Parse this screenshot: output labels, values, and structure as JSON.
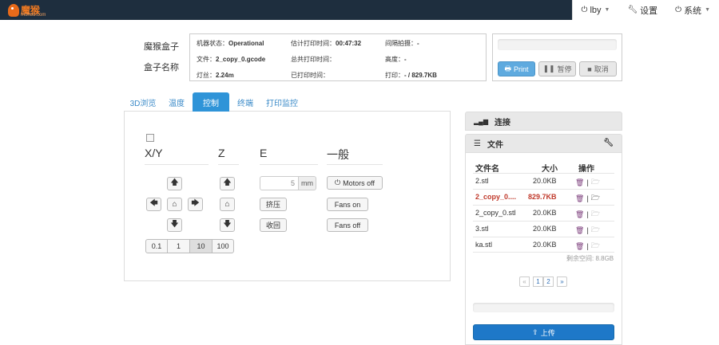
{
  "brand": {
    "name": "魔猴",
    "sub": "mohou.com"
  },
  "nav": {
    "user": "lby",
    "settings": "设置",
    "system": "系统"
  },
  "labels": {
    "box": "魔猴盒子",
    "box_name": "盒子名称"
  },
  "status": {
    "machine_label": "机器状态：",
    "machine_value": "Operational",
    "file_label": "文件：",
    "file_value": "2_copy_0.gcode",
    "filament_label": "灯丝：",
    "filament_value": "2.24m",
    "est_label": "估计打印时间：",
    "est_value": "00:47:32",
    "total_label": "总共打印时间：",
    "total_value": "",
    "printed_label": "已打印时间：",
    "printed_value": "",
    "timelapse_label": "间隔拍摄：",
    "timelapse_value": "-",
    "height_label": "高度：",
    "height_value": "-",
    "print_label": "打印：",
    "print_value": "- / 829.7KB"
  },
  "print_controls": {
    "progress": 0,
    "print": "Print",
    "pause": "暂停",
    "cancel": "取消"
  },
  "tabs": [
    "3D浏览",
    "温度",
    "控制",
    "终端",
    "打印监控"
  ],
  "active_tab": "控制",
  "control": {
    "xy": "X/Y",
    "z": "Z",
    "e": "E",
    "general": "一般",
    "e_amount": "5",
    "e_unit": "mm",
    "extrude": "挤压",
    "retract": "收回",
    "motors_off": "Motors off",
    "fans_on": "Fans on",
    "fans_off": "Fans off",
    "steps": [
      "0.1",
      "1",
      "10",
      "100"
    ],
    "active_step": "10"
  },
  "connection": {
    "title": "连接"
  },
  "files": {
    "title": "文件",
    "col_name": "文件名",
    "col_size": "大小",
    "col_action": "操作",
    "rows": [
      {
        "name": "2.stl",
        "size": "20.0KB"
      },
      {
        "name": "2_copy_0....",
        "size": "829.7KB",
        "highlight": true
      },
      {
        "name": "2_copy_0.stl",
        "size": "20.0KB"
      },
      {
        "name": "3.stl",
        "size": "20.0KB"
      },
      {
        "name": "ka.stl",
        "size": "20.0KB"
      }
    ],
    "free_space": "剩余空间: 8.8GB",
    "pages": [
      "«",
      "1",
      "2",
      "»"
    ],
    "upload_progress": 0,
    "upload": "上传"
  },
  "colors": {
    "navbar": "#1e2e3e",
    "accent": "#2f94d8",
    "highlight_row": "#c0392b",
    "upload": "#1e78c8"
  }
}
